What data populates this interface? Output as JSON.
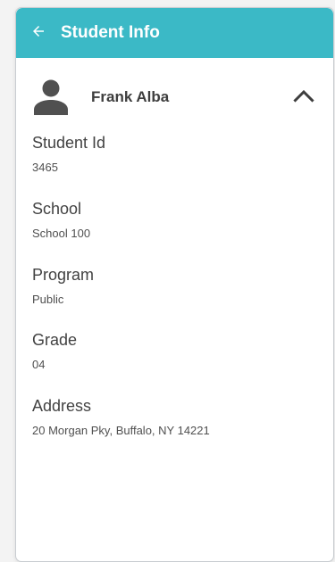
{
  "appbar": {
    "title": "Student Info",
    "back_icon": "arrow-left-icon"
  },
  "student": {
    "name": "Frank Alba",
    "avatar_icon": "person-icon",
    "collapse_icon": "chevron-up-icon"
  },
  "fields": [
    {
      "label": "Student Id",
      "value": "3465"
    },
    {
      "label": "School",
      "value": "School 100"
    },
    {
      "label": "Program",
      "value": "Public"
    },
    {
      "label": "Grade",
      "value": "04"
    },
    {
      "label": "Address",
      "value": "20 Morgan Pky, Buffalo, NY 14221"
    }
  ],
  "colors": {
    "appbar": "#3bb9c6",
    "text": "#424242"
  }
}
